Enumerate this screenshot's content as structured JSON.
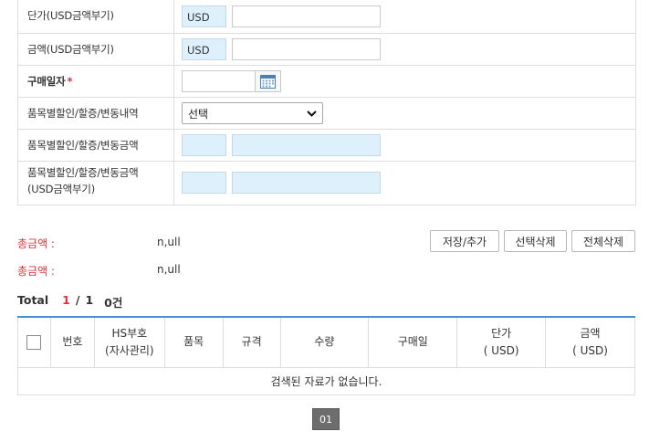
{
  "form": {
    "rows": [
      {
        "label": "단가(USD금액부기)",
        "currency": "USD"
      },
      {
        "label": "금액(USD금액부기)",
        "currency": "USD"
      },
      {
        "label": "구매일자",
        "required_mark": "*"
      },
      {
        "label": "품목별할인/할증/변동내역",
        "select_value": "선택"
      },
      {
        "label": "품목별할인/할증/변동금액"
      },
      {
        "label_line1": "품목별할인/할증/변동금액",
        "label_line2": "(USD금액부기)"
      }
    ]
  },
  "totals": [
    {
      "label": "총금액 :",
      "value": "n,ull"
    },
    {
      "label": "총금액 :",
      "value": "n,ull"
    }
  ],
  "buttons": {
    "save_add": "저장/추가",
    "delete_selected": "선택삭제",
    "delete_all": "전체삭제"
  },
  "count": {
    "label": "Total",
    "page_current": "1",
    "separator": "/",
    "page_total": "1",
    "records": "0건"
  },
  "table": {
    "headers": {
      "number": "번호",
      "hs_line1": "HS부호",
      "hs_line2": "(자사관리)",
      "item": "품목",
      "spec": "규격",
      "quantity": "수량",
      "purchase_date": "구매일",
      "unit_price_line1": "단가",
      "unit_price_line2": "( USD)",
      "amount_line1": "금액",
      "amount_line2": "( USD)"
    },
    "empty_message": "검색된 자료가 없습니다."
  },
  "pagination": {
    "current": "01"
  },
  "colors": {
    "accent_red": "#e0313a",
    "header_line": "#4a8fd4",
    "currency_tint": "#ddf0fc"
  },
  "icons": {
    "calendar": "calendar-icon",
    "select_arrow": "chevron-down-icon"
  }
}
